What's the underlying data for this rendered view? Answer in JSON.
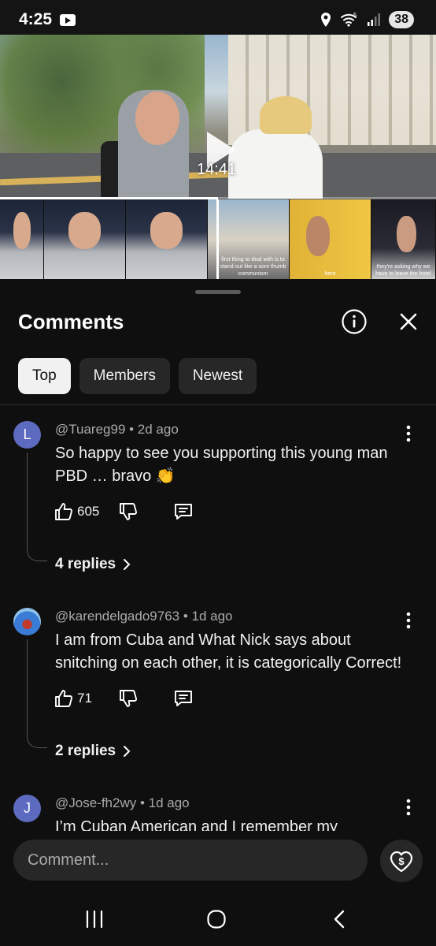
{
  "status_bar": {
    "time": "4:25",
    "battery": "38",
    "wifi_badge": "5"
  },
  "video": {
    "timestamp": "14:41",
    "progress": 0.5
  },
  "storyboard": {
    "captions": [
      "first thing to deal with is to stand out like a sore thumb",
      "they're asking why we have to leave the hotel"
    ],
    "caption_left": "communism",
    "caption_right": "here"
  },
  "sheet": {
    "title": "Comments",
    "chips": [
      {
        "label": "Top",
        "active": true
      },
      {
        "label": "Members",
        "active": false
      },
      {
        "label": "Newest",
        "active": false
      }
    ]
  },
  "comments": [
    {
      "avatar_letter": "L",
      "avatar_color": "#5c6bc0",
      "author": "@Tuareg99",
      "age": "2d ago",
      "meta": "@Tuareg99 • 2d ago",
      "text": "So happy to see you supporting this young man PBD … bravo 👏",
      "likes": "605",
      "replies": "4 replies"
    },
    {
      "avatar_letter": "",
      "avatar_color": "#3a7bd5",
      "author": "@karendelgado9763",
      "age": "1d ago",
      "meta": "@karendelgado9763 • 1d ago",
      "text": "I am from Cuba and What Nick says about snitching on each other, it is categorically Correct!",
      "likes": "71",
      "replies": "2 replies"
    },
    {
      "avatar_letter": "J",
      "avatar_color": "#5c6bc0",
      "author": "@Jose-fh2wy",
      "age": "1d ago",
      "meta": "@Jose-fh2wy • 1d ago",
      "text": "I’m Cuban American and I remember my",
      "likes": "",
      "replies": ""
    }
  ],
  "composer": {
    "placeholder": "Comment..."
  },
  "icons": {
    "info": "info-icon",
    "close": "close-icon",
    "more": "more-vert-icon",
    "like": "thumbs-up-icon",
    "dislike": "thumbs-down-icon",
    "reply": "reply-icon",
    "thanks": "super-thanks-icon",
    "recents": "recents-icon",
    "home": "home-icon",
    "back": "back-icon"
  }
}
